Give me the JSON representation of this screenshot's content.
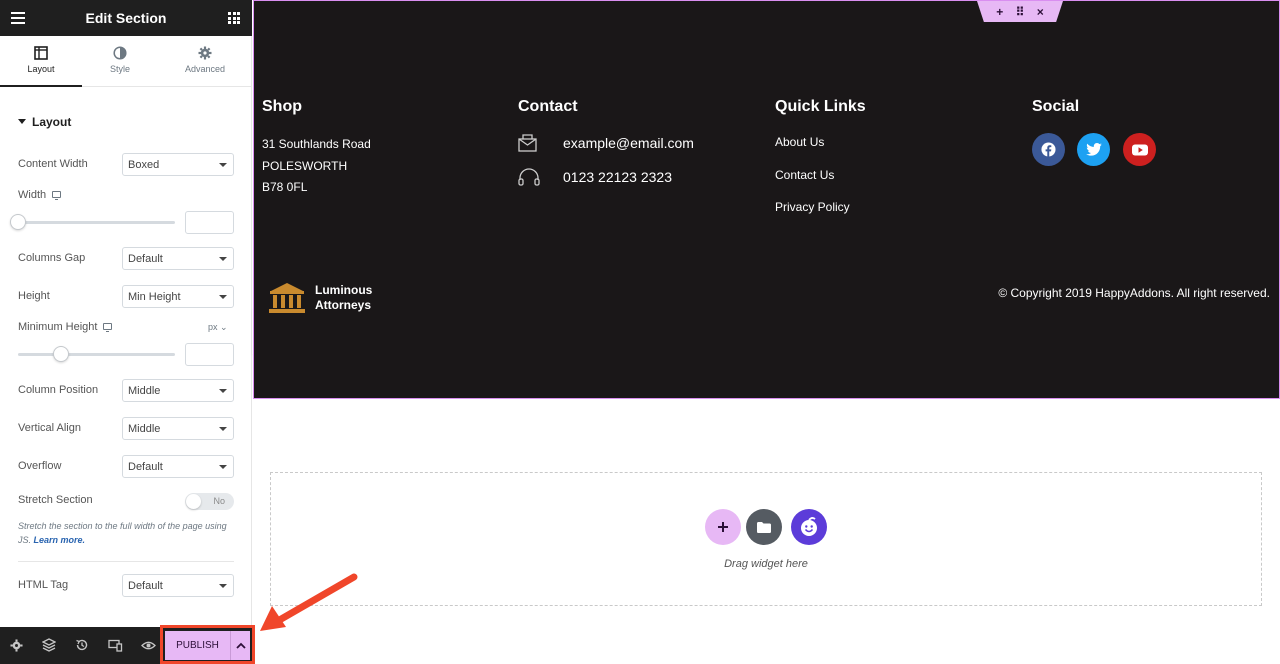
{
  "editor": {
    "title": "Edit Section",
    "tabs": [
      {
        "label": "Layout",
        "icon": "layout-icon"
      },
      {
        "label": "Style",
        "icon": "style-icon"
      },
      {
        "label": "Advanced",
        "icon": "gear-icon"
      }
    ],
    "section_heading": "Layout",
    "controls": {
      "content_width": {
        "label": "Content Width",
        "value": "Boxed"
      },
      "width": {
        "label": "Width"
      },
      "columns_gap": {
        "label": "Columns Gap",
        "value": "Default"
      },
      "height": {
        "label": "Height",
        "value": "Min Height"
      },
      "minimum_height": {
        "label": "Minimum Height",
        "unit": "px"
      },
      "column_position": {
        "label": "Column Position",
        "value": "Middle"
      },
      "vertical_align": {
        "label": "Vertical Align",
        "value": "Middle"
      },
      "overflow": {
        "label": "Overflow",
        "value": "Default"
      },
      "stretch_section": {
        "label": "Stretch Section",
        "toggle": "No"
      },
      "stretch_hint": "Stretch the section to the full width of the page using JS.",
      "learn_more": "Learn more.",
      "html_tag": {
        "label": "HTML Tag",
        "value": "Default"
      }
    },
    "publish_label": "PUBLISH"
  },
  "footer": {
    "shop": {
      "title": "Shop",
      "lines": [
        "31 Southlands Road",
        "POLESWORTH",
        "B78 0FL"
      ]
    },
    "contact": {
      "title": "Contact",
      "email": "example@email.com",
      "phone": "0123 22123 2323"
    },
    "quick_links": {
      "title": "Quick Links",
      "links": [
        "About Us",
        "Contact Us",
        "Privacy Policy"
      ]
    },
    "social": {
      "title": "Social",
      "icons": [
        {
          "name": "facebook-icon",
          "color": "#3b5998"
        },
        {
          "name": "twitter-icon",
          "color": "#1da1f2"
        },
        {
          "name": "youtube-icon",
          "color": "#cd201f"
        }
      ]
    },
    "logo": {
      "line1": "Luminous",
      "line2": "Attorneys"
    },
    "copyright": "© Copyright 2019 HappyAddons. All right reserved."
  },
  "dropzone": {
    "text": "Drag widget here"
  },
  "colors": {
    "accent_pink": "#e7b8f5",
    "footer_bg": "#1a1718",
    "highlight_red": "#f0462a"
  }
}
